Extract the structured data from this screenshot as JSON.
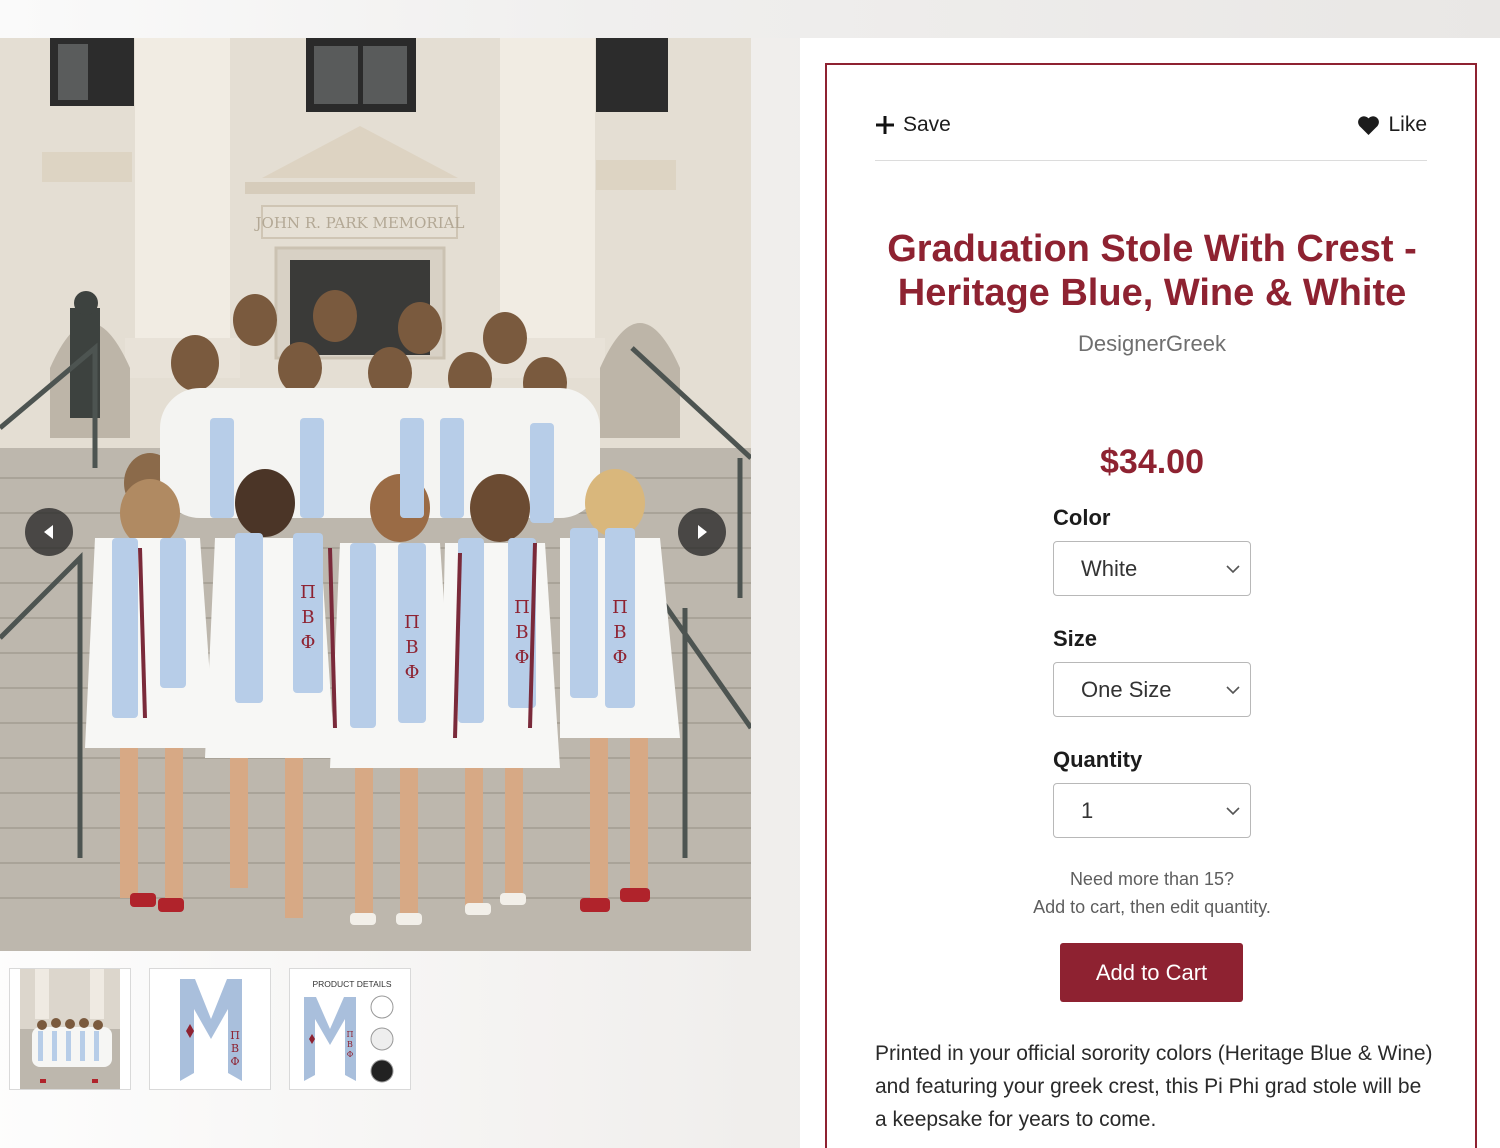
{
  "actions": {
    "save_label": "Save",
    "like_label": "Like"
  },
  "product": {
    "title": "Graduation Stole With Crest - Heritage Blue, Wine & White",
    "brand": "DesignerGreek",
    "price": "$34.00",
    "description": "Printed in your official sorority colors (Heritage Blue & Wine) and featuring your greek crest, this Pi Phi grad stole will be a keepsake for years to come."
  },
  "options": {
    "color": {
      "label": "Color",
      "selected": "White"
    },
    "size": {
      "label": "Size",
      "selected": "One Size"
    },
    "quantity": {
      "label": "Quantity",
      "selected": "1"
    }
  },
  "hint": {
    "line1": "Need more than 15?",
    "line2": "Add to cart, then edit quantity."
  },
  "cart": {
    "add_label": "Add to Cart"
  },
  "photo": {
    "building_inscription": "JOHN R. PARK MEMORIAL"
  },
  "thumbnails": [
    {
      "name": "group-photo-thumbnail"
    },
    {
      "name": "stole-front-thumbnail",
      "letters": [
        "Π",
        "Β",
        "Φ"
      ]
    },
    {
      "name": "product-details-thumbnail",
      "caption": "PRODUCT DETAILS",
      "letters": [
        "Π",
        "Β",
        "Φ"
      ]
    }
  ],
  "colors": {
    "accent": "#8e2231",
    "stole_blue": "#b7cde8"
  }
}
